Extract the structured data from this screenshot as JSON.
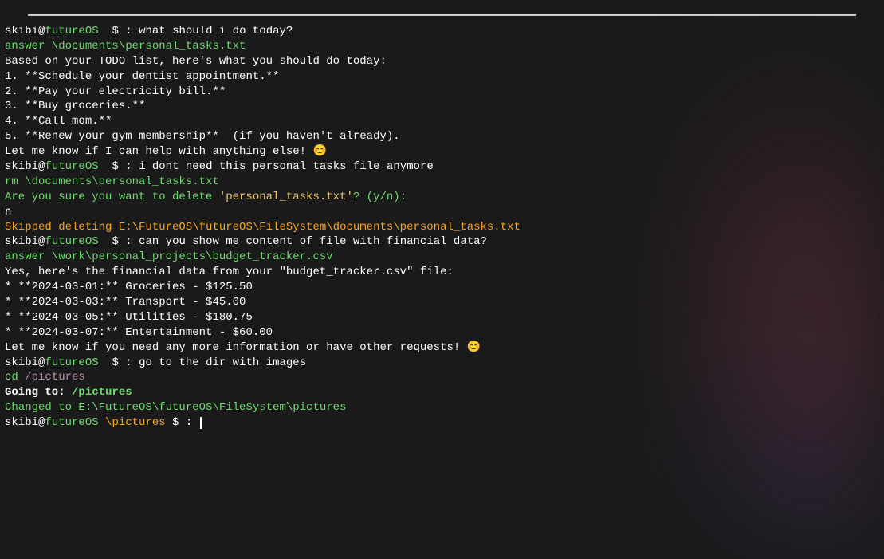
{
  "prompt": {
    "user": "skibi@",
    "host": "futureOS",
    "sep": "  $ : "
  },
  "l1": {
    "cmd": "what should i do today?"
  },
  "l2": "answer \\documents\\personal_tasks.txt",
  "l3": "Based on your TODO list, here's what you should do today:",
  "l4": "",
  "l5": "1. **Schedule your dentist appointment.**",
  "l6": "2. **Pay your electricity bill.**",
  "l7": "3. **Buy groceries.**",
  "l8": "4. **Call mom.**",
  "l9": "5. **Renew your gym membership**  (if you haven't already).",
  "l10": "",
  "l11": "",
  "l12": "Let me know if I can help with anything else! 😊",
  "l13": {
    "cmd": "i dont need this personal tasks file anymore"
  },
  "l14": "rm \\documents\\personal_tasks.txt",
  "l15a": "Are you sure you want to delete ",
  "l15b": "'personal_tasks.txt'",
  "l15c": "? (y/n):",
  "l16": "n",
  "l17": "Skipped deleting E:\\FutureOS\\futureOS\\FileSystem\\documents\\personal_tasks.txt",
  "l18": {
    "cmd": "can you show me content of file with financial data?"
  },
  "l19": "answer \\work\\personal_projects\\budget_tracker.csv",
  "l20": "Yes, here's the financial data from your \"budget_tracker.csv\" file:",
  "l21": "",
  "l22": "* **2024-03-01:** Groceries - $125.50",
  "l23": "* **2024-03-03:** Transport - $45.00",
  "l24": "* **2024-03-05:** Utilities - $180.75",
  "l25": "* **2024-03-07:** Entertainment - $60.00",
  "l26": "",
  "l27": "",
  "l28": "Let me know if you need any more information or have other requests! 😊",
  "l29": {
    "cmd": "go to the dir with images"
  },
  "l30a": "cd ",
  "l30b": "/pictures",
  "l31": "",
  "l32a": "Going to: ",
  "l32b": "/pictures",
  "l33": "Changed to E:\\FutureOS\\futureOS\\FileSystem\\pictures",
  "l34": {
    "path": " \\pictures",
    "sep": " $ : "
  }
}
